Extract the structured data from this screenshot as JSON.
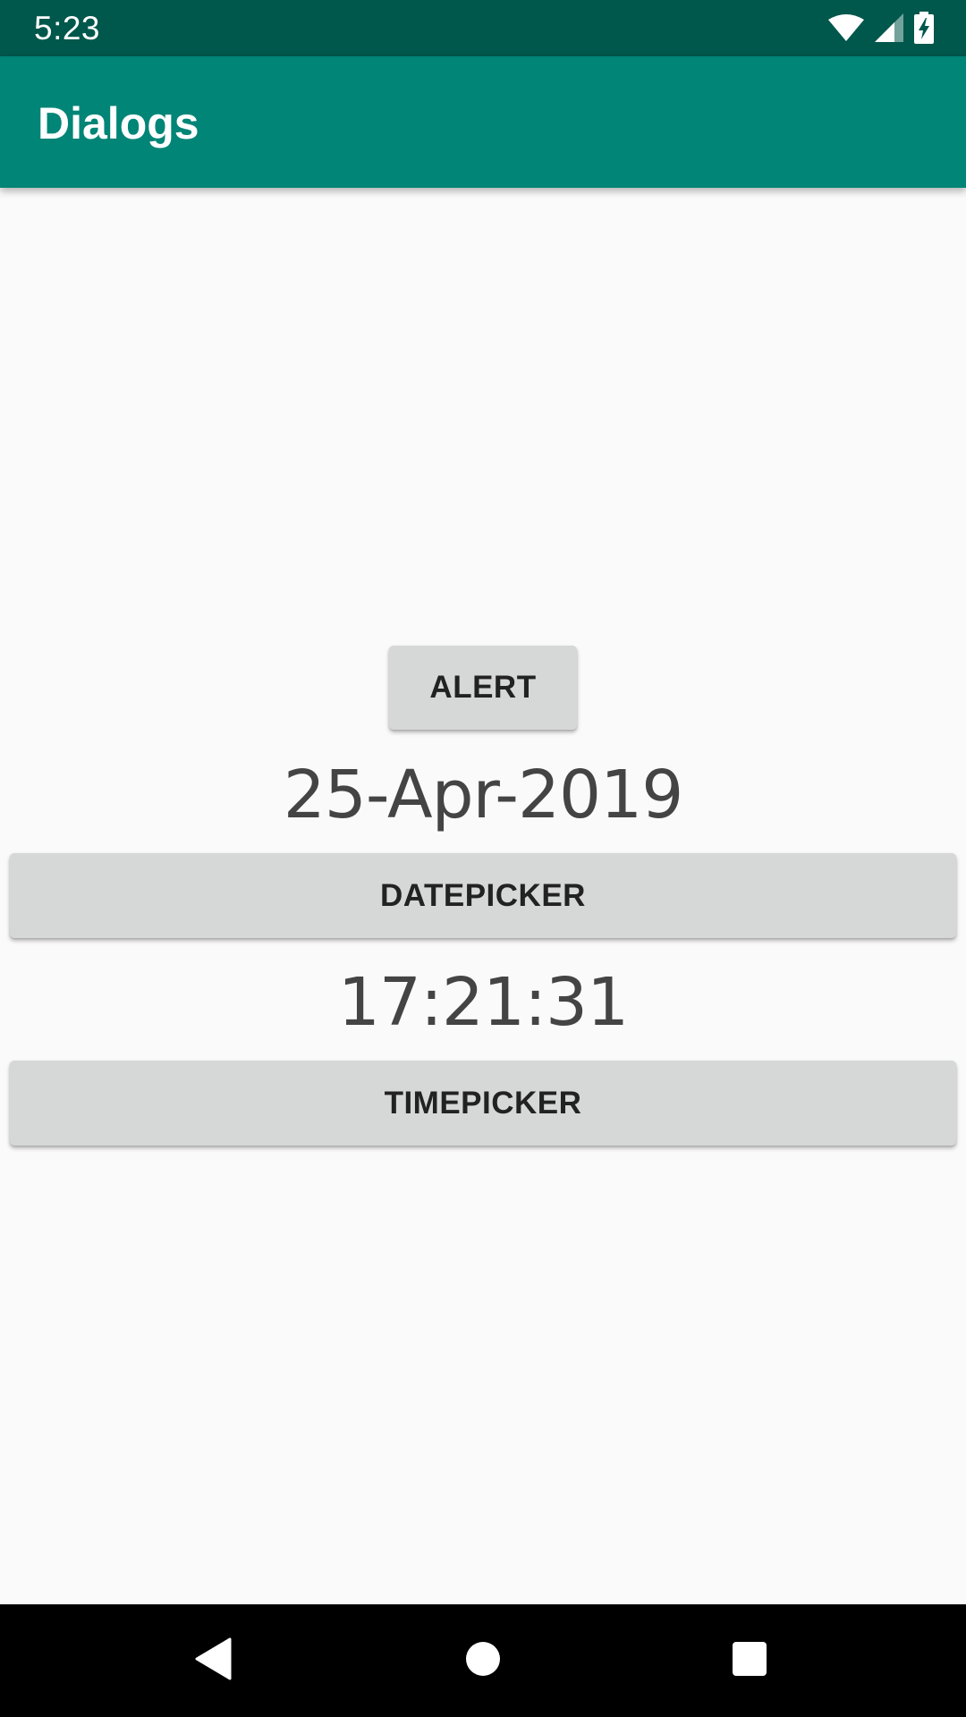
{
  "status_bar": {
    "time": "5:23",
    "icons": [
      "wifi-icon",
      "cell-signal-icon",
      "battery-charging-icon"
    ],
    "background": "#00574b"
  },
  "app_bar": {
    "title": "Dialogs",
    "background": "#008577"
  },
  "main": {
    "alert_button_label": "ALERT",
    "date_value": "25-Apr-2019",
    "datepicker_button_label": "DATEPICKER",
    "time_value": "17:21:31",
    "timepicker_button_label": "TIMEPICKER",
    "button_color": "#d6d7d7"
  },
  "nav_bar": {
    "icons": [
      "back-icon",
      "home-icon",
      "recents-icon"
    ]
  }
}
